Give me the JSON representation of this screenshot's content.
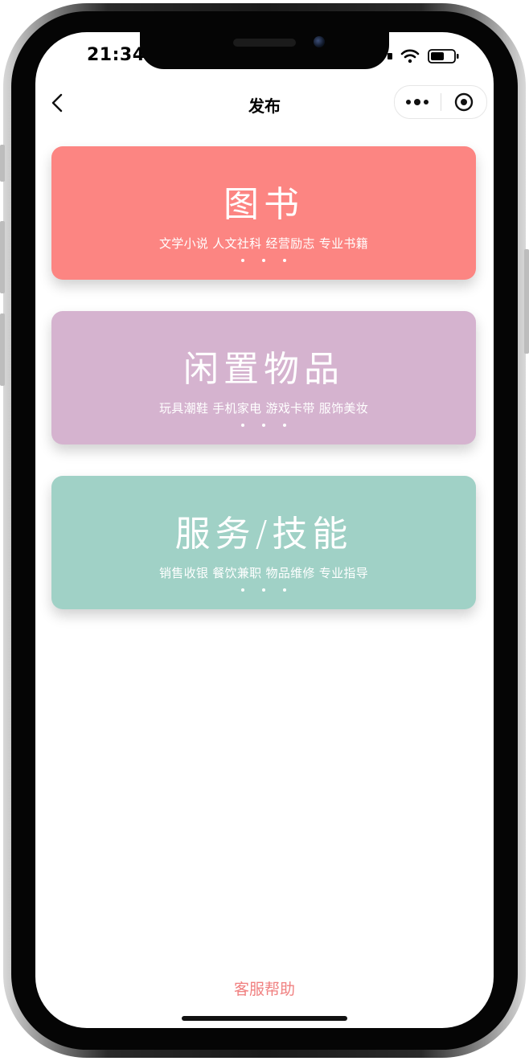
{
  "status": {
    "time": "21:34"
  },
  "navbar": {
    "title": "发布"
  },
  "cards": [
    {
      "title": "图书",
      "subtitle": "文学小说 人文社科 经营励志 专业书籍",
      "color": "#fc8582"
    },
    {
      "title": "闲置物品",
      "subtitle": "玩具潮鞋 手机家电 游戏卡带 服饰美妆",
      "color": "#d5b3cf"
    },
    {
      "title": "服务/技能",
      "subtitle": "销售收银 餐饮兼职 物品维修 专业指导",
      "color": "#a0d1c6"
    }
  ],
  "footer": {
    "help_label": "客服帮助",
    "help_color": "#f08080"
  },
  "icons": {
    "back": "chevron-left-icon",
    "more": "more-dots-icon",
    "close": "target-circle-icon",
    "wifi": "wifi-icon",
    "battery": "battery-icon",
    "signal": "signal-icon"
  }
}
